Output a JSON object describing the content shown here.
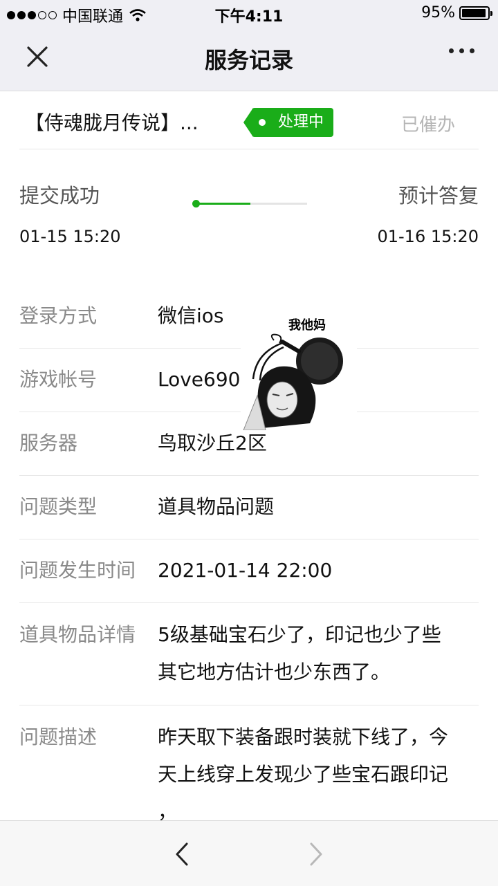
{
  "status_bar": {
    "carrier": "中国联通",
    "time": "下午4:11",
    "battery": "95%",
    "battery_level": 0.95,
    "signal_bars": 3
  },
  "nav": {
    "title": "服务记录",
    "close_icon": "close-icon",
    "more_icon": "more-icon"
  },
  "ticket": {
    "name": "【侍魂胧月传说】...",
    "status_badge": "处理中",
    "urge_label": "已催办",
    "accent_color": "#1aad19"
  },
  "progress": {
    "start_label": "提交成功",
    "end_label": "预计答复",
    "start_time": "01-15 15:20",
    "end_time": "01-16 15:20",
    "fraction": 0.5
  },
  "details": {
    "login_label": "登录方式",
    "login_value": "微信ios",
    "account_label": "游戏帐号",
    "account_value": "Love690",
    "server_label": "服务器",
    "server_value": "鸟取沙丘2区",
    "type_label": "问题类型",
    "type_value": "道具物品问题",
    "time_label": "问题发生时间",
    "time_value": "2021-01-14 22:00",
    "item_label": "道具物品详情",
    "item_value_line1": "5级基础宝石少了，印记也少了些",
    "item_value_line2": "其它地方估计也少东西了。",
    "desc_label": "问题描述",
    "desc_line1": "昨天取下装备跟时装就下线了，今",
    "desc_line2": "天上线穿上发现少了些宝石跟印记",
    "desc_line3": "，"
  },
  "sticker": {
    "caption": "我他妈"
  },
  "bottom": {
    "back_icon": "chevron-left-icon",
    "forward_icon": "chevron-right-icon"
  }
}
